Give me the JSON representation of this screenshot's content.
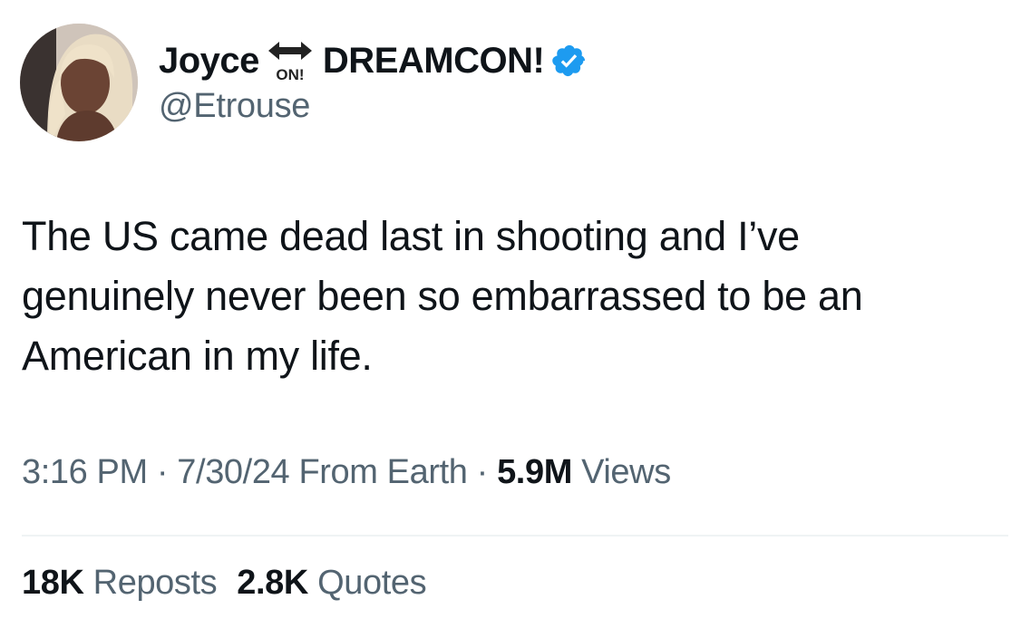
{
  "author": {
    "display_name": "Joyce",
    "name_suffix": "DREAMCON!",
    "emoji_label": "ON!",
    "handle": "@Etrouse",
    "verified_color": "#1d9bf0"
  },
  "tweet": {
    "text": "The US came dead last in shooting and I’ve\ngenuinely never been so embarrassed to be an\nAmerican in my life."
  },
  "meta": {
    "time": "3:16 PM",
    "sep1": " · ",
    "date": "7/30/24",
    "location": " From Earth",
    "sep2": " · ",
    "views_count": "5.9M",
    "views_label": " Views"
  },
  "stats": {
    "reposts_count": "18K",
    "reposts_label": " Reposts",
    "quotes_count": "2.8K",
    "quotes_label": " Quotes"
  }
}
